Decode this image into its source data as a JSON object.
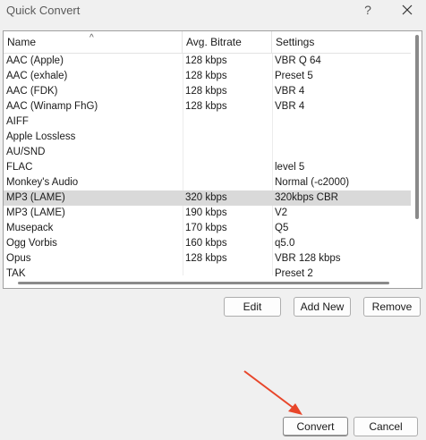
{
  "window": {
    "title": "Quick Convert",
    "help_glyph": "?",
    "close_glyph": "close-icon"
  },
  "table": {
    "columns": [
      "Name",
      "Avg. Bitrate",
      "Settings"
    ],
    "sort_indicator": "^",
    "rows": [
      {
        "name": "AAC (Apple)",
        "bitrate": "128 kbps",
        "settings": "VBR Q 64"
      },
      {
        "name": "AAC (exhale)",
        "bitrate": "128 kbps",
        "settings": "Preset 5"
      },
      {
        "name": "AAC (FDK)",
        "bitrate": "128 kbps",
        "settings": "VBR 4"
      },
      {
        "name": "AAC (Winamp FhG)",
        "bitrate": "128 kbps",
        "settings": "VBR 4"
      },
      {
        "name": "AIFF",
        "bitrate": "",
        "settings": ""
      },
      {
        "name": "Apple Lossless",
        "bitrate": "",
        "settings": ""
      },
      {
        "name": "AU/SND",
        "bitrate": "",
        "settings": ""
      },
      {
        "name": "FLAC",
        "bitrate": "",
        "settings": "level 5"
      },
      {
        "name": "Monkey's Audio",
        "bitrate": "",
        "settings": "Normal (-c2000)"
      },
      {
        "name": "MP3 (LAME)",
        "bitrate": "320 kbps",
        "settings": "320kbps CBR",
        "selected": true
      },
      {
        "name": "MP3 (LAME)",
        "bitrate": "190 kbps",
        "settings": "V2"
      },
      {
        "name": "Musepack",
        "bitrate": "170 kbps",
        "settings": "Q5"
      },
      {
        "name": "Ogg Vorbis",
        "bitrate": "160 kbps",
        "settings": "q5.0"
      },
      {
        "name": "Opus",
        "bitrate": "128 kbps",
        "settings": "VBR 128 kbps"
      },
      {
        "name": "TAK",
        "bitrate": "",
        "settings": "Preset 2"
      }
    ]
  },
  "buttons": {
    "edit": "Edit",
    "add_new": "Add New",
    "remove": "Remove",
    "convert": "Convert",
    "cancel": "Cancel"
  },
  "colors": {
    "selected_row": "#d9d9d9",
    "annotation_arrow": "#e8462a"
  }
}
